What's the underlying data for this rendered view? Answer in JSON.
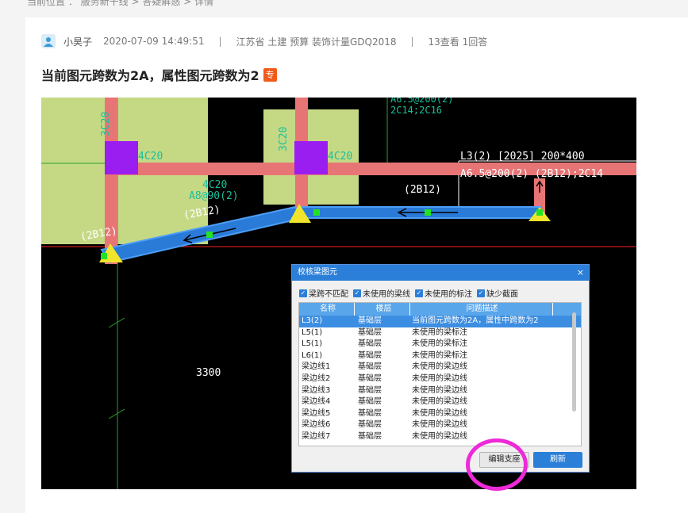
{
  "breadcrumb": "当前位置 ： 服务新干线 > 答疑解惑 > 详情",
  "post": {
    "username": "小昊子",
    "datetime": "2020-07-09 14:49:51",
    "category": "江苏省 土建 预算 装饰计量GDQ2018",
    "stats": "13查看 1回答",
    "title": "当前图元跨数为2A，属性图元跨数为2",
    "badge": "专"
  },
  "cad": {
    "labels": {
      "beam_label_line1": "L3(2) [2025] 200*400",
      "beam_label_line2": "A6.5@200(2) (2B12);2C14",
      "span_right": "(2B12)",
      "span_mid": "(2B12)",
      "span_left": "(2B12)",
      "col_label_left": "4C20",
      "col_label_mid": "4C20",
      "col_label_under": "4C20",
      "stirrup": "A8@90(2)",
      "col_vert_left": "3C20",
      "col_vert_mid": "3C20",
      "top_text_1": "A6.5@200(2)",
      "top_text_2": "2C14;2C16",
      "dimension": "3300"
    }
  },
  "dialog": {
    "title": "校核梁图元",
    "close": "×",
    "checkboxes": [
      {
        "label": "梁跨不匹配",
        "checked": true
      },
      {
        "label": "未使用的梁线",
        "checked": true
      },
      {
        "label": "未使用的标注",
        "checked": true
      },
      {
        "label": "缺少截面",
        "checked": true
      }
    ],
    "columns": [
      "名称",
      "楼层",
      "问题描述"
    ],
    "rows": [
      [
        "L3(2)",
        "基础层",
        "当前图元跨数为2A，属性中跨数为2"
      ],
      [
        "L5(1)",
        "基础层",
        "未使用的梁标注"
      ],
      [
        "L5(1)",
        "基础层",
        "未使用的梁标注"
      ],
      [
        "L6(1)",
        "基础层",
        "未使用的梁标注"
      ],
      [
        "梁边线1",
        "基础层",
        "未使用的梁边线"
      ],
      [
        "梁边线2",
        "基础层",
        "未使用的梁边线"
      ],
      [
        "梁边线3",
        "基础层",
        "未使用的梁边线"
      ],
      [
        "梁边线4",
        "基础层",
        "未使用的梁边线"
      ],
      [
        "梁边线5",
        "基础层",
        "未使用的梁边线"
      ],
      [
        "梁边线6",
        "基础层",
        "未使用的梁边线"
      ],
      [
        "梁边线7",
        "基础层",
        "未使用的梁边线"
      ]
    ],
    "edit_button": "编辑支座",
    "refresh_button": "刷新"
  }
}
